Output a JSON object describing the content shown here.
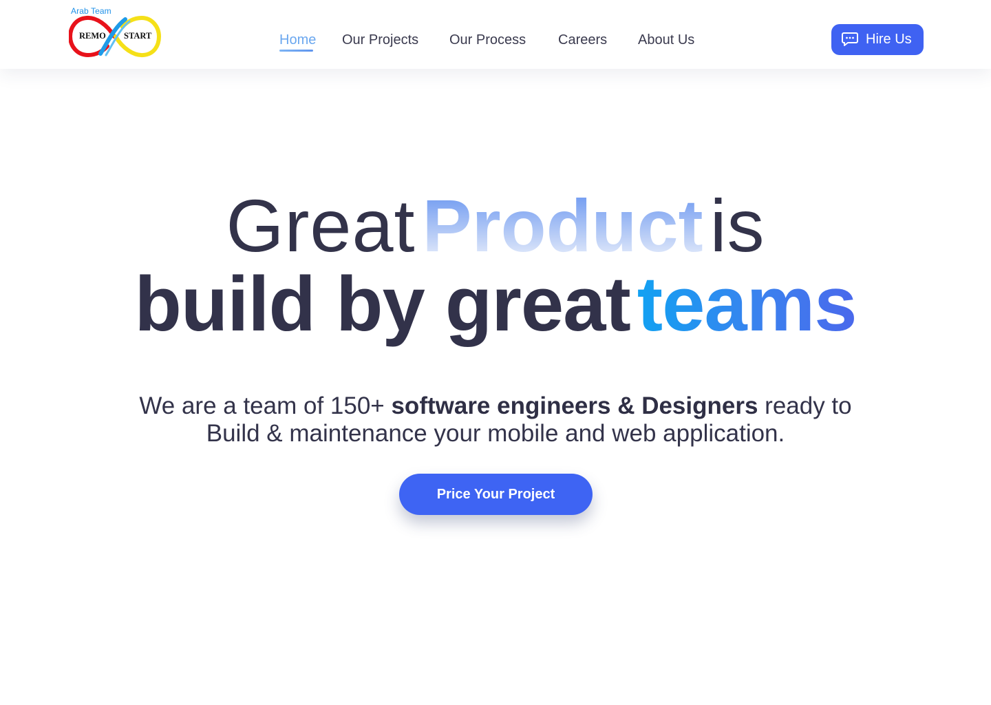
{
  "brand": {
    "tagline": "Arab Team",
    "left_word": "REMO",
    "right_word": "START",
    "logo_colors": [
      "#e8121b",
      "#1e9be8",
      "#f5e018"
    ]
  },
  "nav": {
    "items": [
      {
        "label": "Home",
        "active": true
      },
      {
        "label": "Our Projects",
        "active": false
      },
      {
        "label": "Our Process",
        "active": false
      },
      {
        "label": "Careers",
        "active": false
      },
      {
        "label": "About Us",
        "active": false
      }
    ],
    "active_color": "#6aa7ef"
  },
  "header": {
    "hire_button": {
      "label": "Hire Us",
      "icon": "chat-bubble-icon"
    }
  },
  "hero": {
    "line1": {
      "pre": "Great",
      "highlight": "Product",
      "post": "is"
    },
    "line2": {
      "pre": "build by great",
      "highlight": "teams"
    },
    "subtitle": {
      "part1": "We are a team of 150+ ",
      "bold": "software engineers & Designers",
      "part2": " ready to",
      "line2": "Build & maintenance your mobile and web application."
    },
    "cta_label": "Price Your Project"
  },
  "colors": {
    "primary": "#3f62f2",
    "text_dark": "#33334a",
    "teams_gradient": [
      "#0fa3f2",
      "#4a68ec"
    ]
  }
}
